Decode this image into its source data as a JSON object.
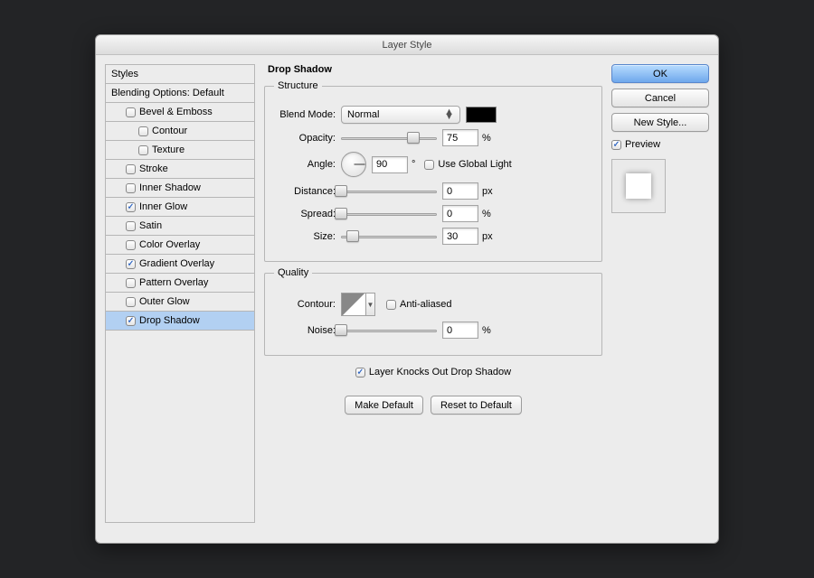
{
  "window": {
    "title": "Layer Style"
  },
  "styles": {
    "header": "Styles",
    "blending": "Blending Options: Default",
    "items": [
      {
        "label": "Bevel & Emboss",
        "checked": false,
        "indent": 1
      },
      {
        "label": "Contour",
        "checked": false,
        "indent": 2
      },
      {
        "label": "Texture",
        "checked": false,
        "indent": 2
      },
      {
        "label": "Stroke",
        "checked": false,
        "indent": 1
      },
      {
        "label": "Inner Shadow",
        "checked": false,
        "indent": 1
      },
      {
        "label": "Inner Glow",
        "checked": true,
        "indent": 1
      },
      {
        "label": "Satin",
        "checked": false,
        "indent": 1
      },
      {
        "label": "Color Overlay",
        "checked": false,
        "indent": 1
      },
      {
        "label": "Gradient Overlay",
        "checked": true,
        "indent": 1
      },
      {
        "label": "Pattern Overlay",
        "checked": false,
        "indent": 1
      },
      {
        "label": "Outer Glow",
        "checked": false,
        "indent": 1
      },
      {
        "label": "Drop Shadow",
        "checked": true,
        "indent": 1,
        "selected": true
      }
    ]
  },
  "panel": {
    "title": "Drop Shadow",
    "structure": {
      "legend": "Structure",
      "blend_mode_label": "Blend Mode:",
      "blend_mode_value": "Normal",
      "color": "#000000",
      "opacity_label": "Opacity:",
      "opacity_value": "75",
      "opacity_unit": "%",
      "angle_label": "Angle:",
      "angle_value": "90",
      "angle_unit": "°",
      "global_light_label": "Use Global Light",
      "global_light_checked": false,
      "distance_label": "Distance:",
      "distance_value": "0",
      "distance_unit": "px",
      "spread_label": "Spread:",
      "spread_value": "0",
      "spread_unit": "%",
      "size_label": "Size:",
      "size_value": "30",
      "size_unit": "px"
    },
    "quality": {
      "legend": "Quality",
      "contour_label": "Contour:",
      "antialiased_label": "Anti-aliased",
      "antialiased_checked": false,
      "noise_label": "Noise:",
      "noise_value": "0",
      "noise_unit": "%"
    },
    "knockout_label": "Layer Knocks Out Drop Shadow",
    "knockout_checked": true,
    "make_default": "Make Default",
    "reset_default": "Reset to Default"
  },
  "right": {
    "ok": "OK",
    "cancel": "Cancel",
    "new_style": "New Style...",
    "preview_label": "Preview",
    "preview_checked": true
  }
}
